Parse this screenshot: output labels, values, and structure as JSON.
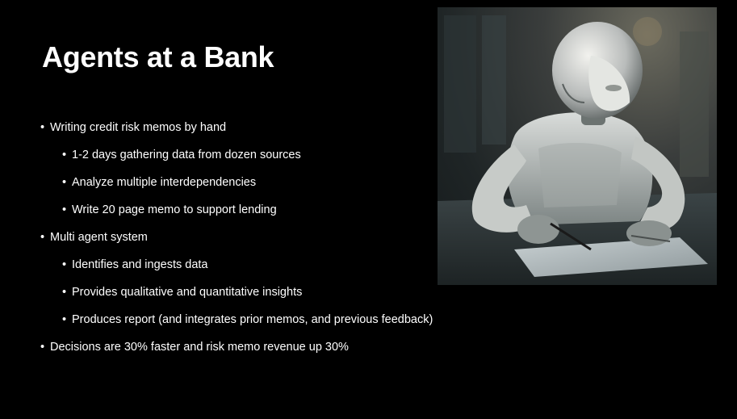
{
  "slide": {
    "title": "Agents at a Bank",
    "bullets": [
      {
        "level": 1,
        "text": "Writing credit risk memos by hand"
      },
      {
        "level": 2,
        "text": "1-2 days gathering data from dozen sources"
      },
      {
        "level": 2,
        "text": "Analyze multiple interdependencies"
      },
      {
        "level": 2,
        "text": "Write 20 page memo to support lending"
      },
      {
        "level": 1,
        "text": "Multi agent system"
      },
      {
        "level": 2,
        "text": "Identifies and ingests data"
      },
      {
        "level": 2,
        "text": "Provides qualitative and quantitative insights"
      },
      {
        "level": 2,
        "text": "Produces report (and integrates prior memos, and previous feedback)"
      },
      {
        "level": 1,
        "text": "Decisions are 30% faster and risk memo revenue up 30%"
      }
    ],
    "image": {
      "icon": "robot-writing-image"
    }
  },
  "colors": {
    "background": "#000000",
    "text": "#ffffff"
  }
}
